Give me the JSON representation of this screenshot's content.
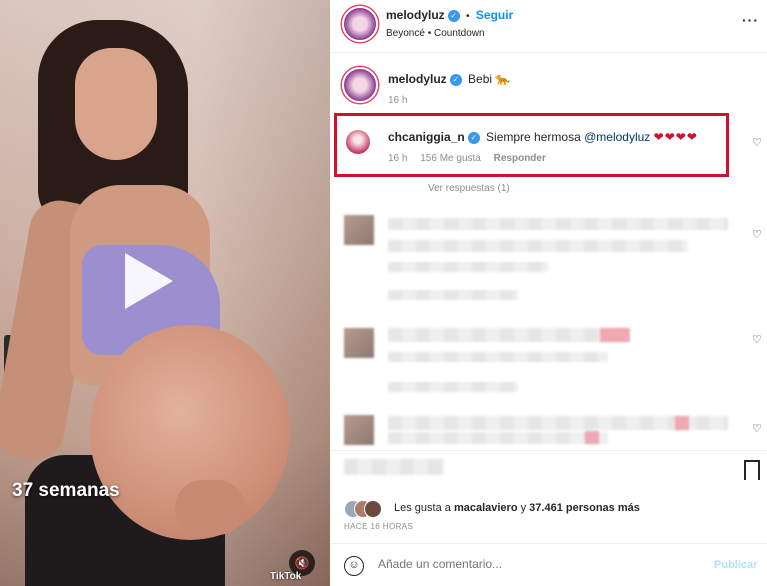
{
  "video": {
    "caption": "37 semanas",
    "watermark": "TikTok",
    "mute_icon": "mute-icon",
    "play_icon": "play-icon"
  },
  "post_header": {
    "username": "melodyluz",
    "separator": "•",
    "follow_label": "Seguir",
    "audio": "Beyoncé • Countdown",
    "more_icon": "more-options-icon"
  },
  "caption_comment": {
    "username": "melodyluz",
    "text": "Bebi",
    "emoji": "🐆",
    "time": "16 h"
  },
  "highlighted_comment": {
    "username": "chcaniggia_n",
    "text": "Siempre hermosa",
    "mention": "@melodyluz",
    "hearts": "❤❤❤❤",
    "time": "16 h",
    "likes": "156 Me gusta",
    "reply_label": "Responder",
    "highlight_color": "#d0102c"
  },
  "view_replies": "Ver respuestas (1)",
  "likes": {
    "prefix": "Les gusta a ",
    "user": "macalaviero",
    "middle": " y ",
    "count": "37.461 personas más"
  },
  "time_ago": "HACE 16 HORAS",
  "comment_box": {
    "placeholder": "Añade un comentario...",
    "publish_label": "Publicar"
  },
  "colors": {
    "accent": "#0095f6",
    "verified": "#3897f0",
    "highlight": "#d0102c"
  }
}
